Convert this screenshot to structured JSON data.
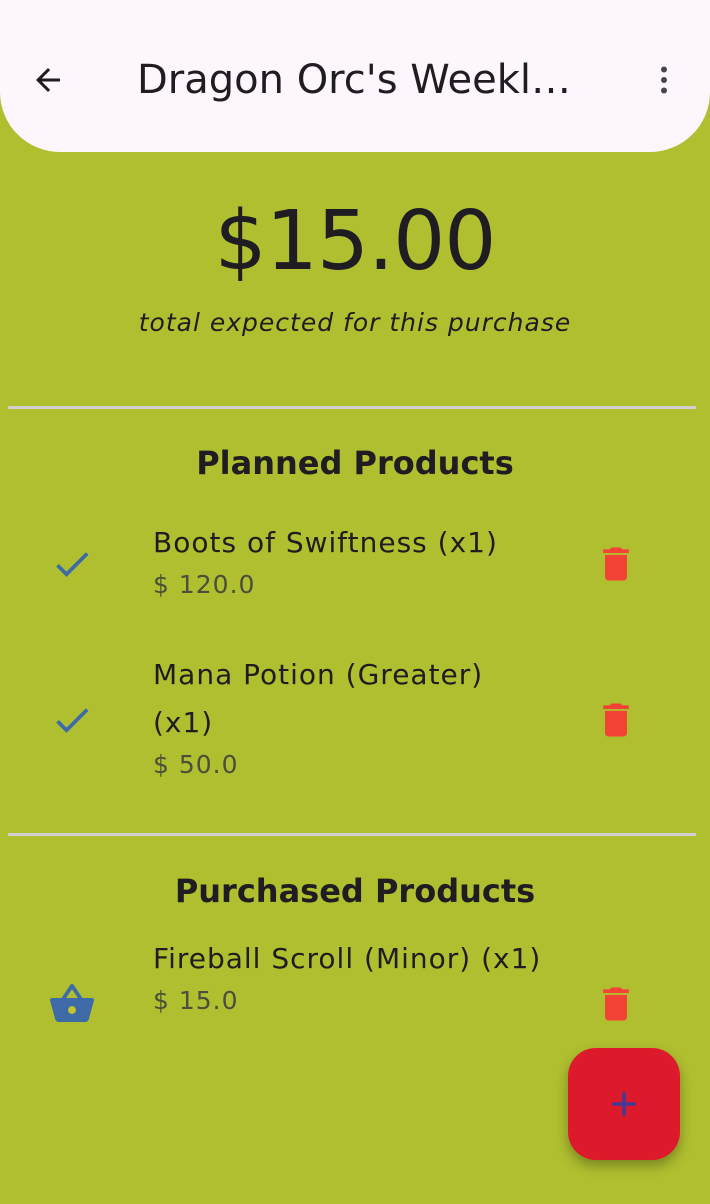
{
  "app_bar": {
    "title": "Dragon Orc's Weekly Shopping",
    "back_icon": "arrow-back-icon",
    "menu_icon": "more-vert-icon"
  },
  "summary": {
    "total": "$15.00",
    "caption": "total expected for this purchase"
  },
  "planned": {
    "title": "Planned Products",
    "items": [
      {
        "name": "Boots of Swiftness (x1)",
        "price": "$ 120.0",
        "icon": "check-icon"
      },
      {
        "name": "Mana Potion (Greater) (x1)",
        "price": "$ 50.0",
        "icon": "check-icon"
      }
    ]
  },
  "purchased": {
    "title": "Purchased Products",
    "items": [
      {
        "name": "Fireball Scroll (Minor) (x1)",
        "price": "$ 15.0",
        "icon": "shopping-basket-icon"
      }
    ]
  },
  "fab": {
    "icon": "plus-icon"
  },
  "colors": {
    "background": "#afbf2f",
    "app_bar": "#fdf6fd",
    "check": "#3e6aa8",
    "delete": "#f44336",
    "fab": "#dc1a2b",
    "fab_icon": "#3b3ba0"
  }
}
